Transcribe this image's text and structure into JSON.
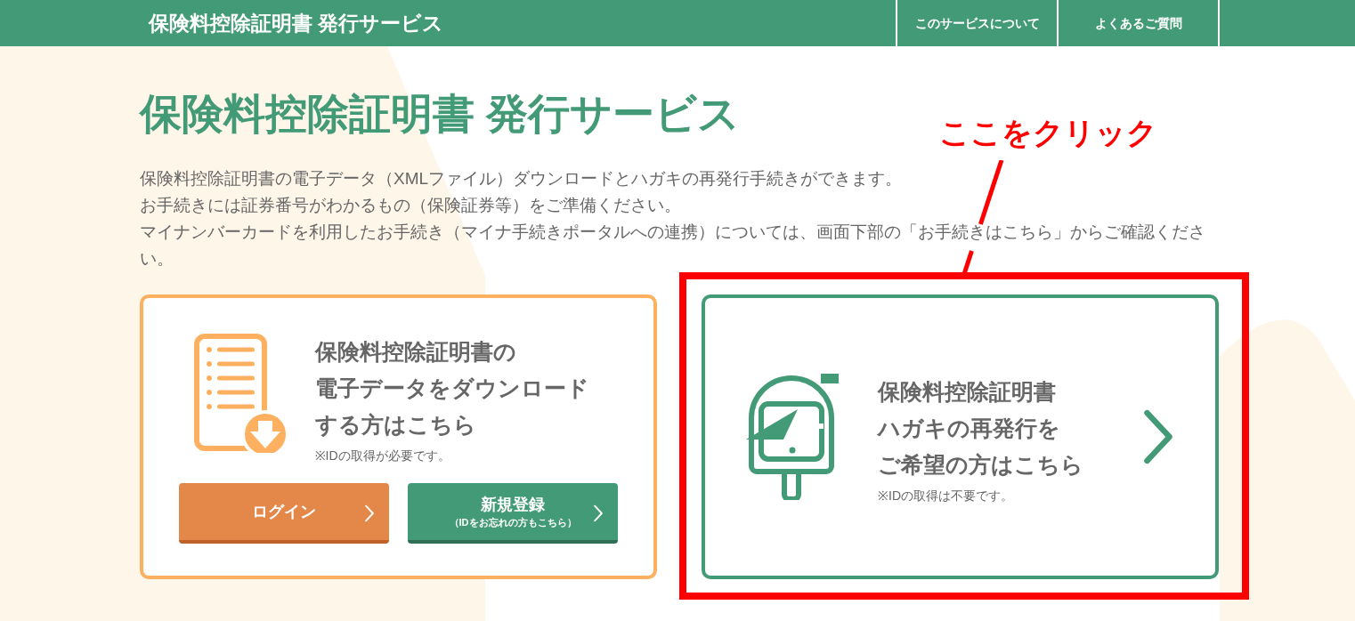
{
  "header": {
    "title": "保険料控除証明書 発行サービス",
    "nav": [
      "このサービスについて",
      "よくあるご質問"
    ]
  },
  "page_title": "保険料控除証明書 発行サービス",
  "intro": [
    "保険料控除証明書の電子データ（XMLファイル）ダウンロードとハガキの再発行手続きができます。",
    "お手続きには証券番号がわかるもの（保険証券等）をご準備ください。",
    "マイナンバーカードを利用したお手続き（マイナ手続きポータルへの連携）については、画面下部の「お手続きはこちら」からご確認ください。"
  ],
  "cards": [
    {
      "kind": "download",
      "heading": [
        "保険料控除証明書の",
        "電子データをダウンロード",
        "する方はこちら"
      ],
      "note": "※IDの取得が必要です。",
      "buttons": [
        {
          "kind": "login",
          "label": "ログイン"
        },
        {
          "kind": "register",
          "label": "新規登録",
          "sublabel": "（IDをお忘れの方もこちら）"
        }
      ]
    },
    {
      "kind": "postcard",
      "heading": [
        "保険料控除証明書",
        "ハガキの再発行を",
        "ご希望の方はこちら"
      ],
      "note": "※IDの取得は不要です。"
    }
  ],
  "annotation": {
    "text": "ここをクリック"
  }
}
